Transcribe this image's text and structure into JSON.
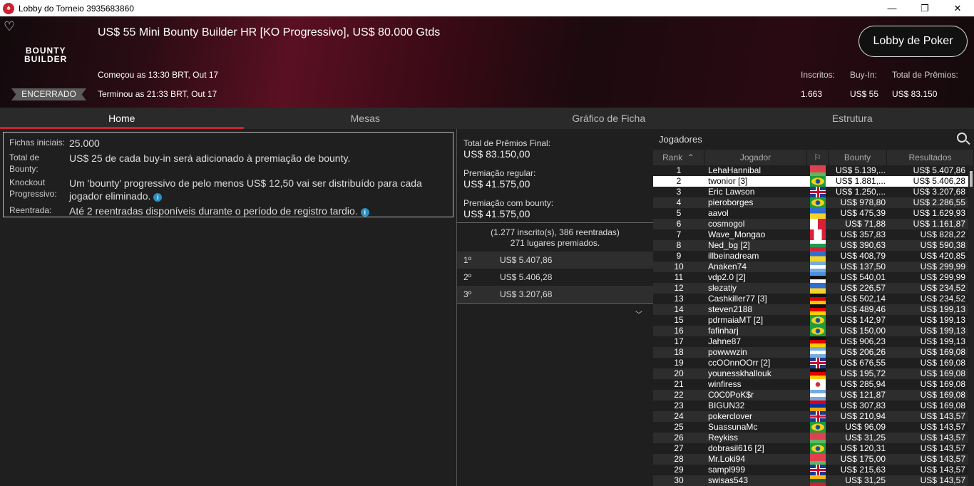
{
  "window": {
    "title": "Lobby do Torneio 3935683860",
    "minimize": "—",
    "maximize": "❐",
    "close": "✕"
  },
  "header": {
    "title": "US$ 55 Mini Bounty Builder HR [KO Progressivo], US$ 80.000 Gtds",
    "logo_line1": "BOUNTY",
    "logo_line2": "BUILDER",
    "status": "ENCERRADO",
    "started": "Começou as 13:30 BRT, Out 17",
    "ended": "Terminou as 21:33 BRT, Out 17",
    "lobby_button": "Lobby de Poker",
    "stats": [
      {
        "label": "Inscritos:",
        "value": "1.663"
      },
      {
        "label": "Buy-In:",
        "value": "US$ 55"
      },
      {
        "label": "Total de Prêmios:",
        "value": "US$ 83.150"
      }
    ]
  },
  "tabs": [
    "Home",
    "Mesas",
    "Gráfico de Ficha",
    "Estrutura"
  ],
  "info": [
    {
      "key": "Fichas iniciais:",
      "value": "25.000"
    },
    {
      "key": "Total de Bounty:",
      "value": "US$ 25 de cada buy-in será adicionado à premiação de bounty."
    },
    {
      "key": "Knockout Progressivo:",
      "value": "Um 'bounty' progressivo de pelo menos US$ 12,50 vai ser distribuído para cada jogador eliminado."
    },
    {
      "key": "Reentrada:",
      "value": "Até 2 reentradas disponíveis durante o período de registro tardio."
    }
  ],
  "prizes": {
    "total_label": "Total de Prêmios Final:",
    "total": "US$ 83.150,00",
    "regular_label": "Premiação regular:",
    "regular": "US$ 41.575,00",
    "bounty_label": "Premiação com bounty:",
    "bounty": "US$ 41.575,00",
    "summary1": "(1.277 inscrito(s), 386 reentradas)",
    "summary2": "271 lugares premiados.",
    "places": [
      {
        "place": "1º",
        "amount": "US$ 5.407,86"
      },
      {
        "place": "2º",
        "amount": "US$ 5.406,28"
      },
      {
        "place": "3º",
        "amount": "US$ 3.207,68"
      }
    ]
  },
  "players": {
    "title": "Jogadores",
    "columns": [
      "Rank",
      "Jogador",
      "",
      "Bounty",
      "Resultados"
    ],
    "selected_rank": 2,
    "rows": [
      [
        "1",
        "LehaHannibal",
        "by",
        "US$ 5.139,...",
        "US$ 5.407,86"
      ],
      [
        "2",
        "twonior [3]",
        "br",
        "US$ 1.881,...",
        "US$ 5.406,28"
      ],
      [
        "3",
        "Eric Lawson",
        "gb",
        "US$ 1.250,...",
        "US$ 3.207,68"
      ],
      [
        "4",
        "pieroborges",
        "br",
        "US$ 978,80",
        "US$ 2.286,55"
      ],
      [
        "5",
        "aavol",
        "ua",
        "US$ 475,39",
        "US$ 1.629,93"
      ],
      [
        "6",
        "cosmogol",
        "mt",
        "US$ 71,88",
        "US$ 1.161,87"
      ],
      [
        "7",
        "Wave_Mongao",
        "ca",
        "US$ 357,83",
        "US$ 828,22"
      ],
      [
        "8",
        "Ned_bg [2]",
        "bg",
        "US$ 390,63",
        "US$ 590,38"
      ],
      [
        "9",
        "illbeinadream",
        "ua",
        "US$ 408,79",
        "US$ 420,85"
      ],
      [
        "10",
        "Anaken74",
        "ar",
        "US$ 137,50",
        "US$ 299,99"
      ],
      [
        "11",
        "vdp2.0 [2]",
        "ee",
        "US$ 540,01",
        "US$ 299,99"
      ],
      [
        "12",
        "slezatiy",
        "ua",
        "US$ 226,57",
        "US$ 234,52"
      ],
      [
        "13",
        "Cashkiller77 [3]",
        "de",
        "US$ 502,14",
        "US$ 234,52"
      ],
      [
        "14",
        "steven2188",
        "de",
        "US$ 489,46",
        "US$ 199,13"
      ],
      [
        "15",
        "pdrmaiaMT [2]",
        "br",
        "US$ 142,97",
        "US$ 199,13"
      ],
      [
        "16",
        "fafinharj",
        "br",
        "US$ 150,00",
        "US$ 199,13"
      ],
      [
        "17",
        "Jahne87",
        "de",
        "US$ 906,23",
        "US$ 199,13"
      ],
      [
        "18",
        "powwwzin",
        "ar",
        "US$ 206,26",
        "US$ 169,08"
      ],
      [
        "19",
        "ccOOnnOOrr [2]",
        "gb",
        "US$ 676,55",
        "US$ 169,08"
      ],
      [
        "20",
        "younesskhallouk",
        "de",
        "US$ 195,72",
        "US$ 169,08"
      ],
      [
        "21",
        "winfiress",
        "kr",
        "US$ 285,94",
        "US$ 169,08"
      ],
      [
        "22",
        "C0C0PoK$r",
        "ar",
        "US$ 121,87",
        "US$ 169,08"
      ],
      [
        "23",
        "BIGUN32",
        "am",
        "US$ 307,83",
        "US$ 169,08"
      ],
      [
        "24",
        "pokerclover",
        "gb",
        "US$ 210,94",
        "US$ 143,57"
      ],
      [
        "25",
        "SuassunaMc",
        "br",
        "US$ 96,09",
        "US$ 143,57"
      ],
      [
        "26",
        "Reykiss",
        "by",
        "US$ 31,25",
        "US$ 143,57"
      ],
      [
        "27",
        "dobrasil616 [2]",
        "br",
        "US$ 120,31",
        "US$ 143,57"
      ],
      [
        "28",
        "Mr.Loki94",
        "by",
        "US$ 175,00",
        "US$ 143,57"
      ],
      [
        "29",
        "sampl999",
        "gb",
        "US$ 215,63",
        "US$ 143,57"
      ],
      [
        "30",
        "swisas543",
        "lt",
        "US$ 31,25",
        "US$ 143,57"
      ]
    ]
  }
}
